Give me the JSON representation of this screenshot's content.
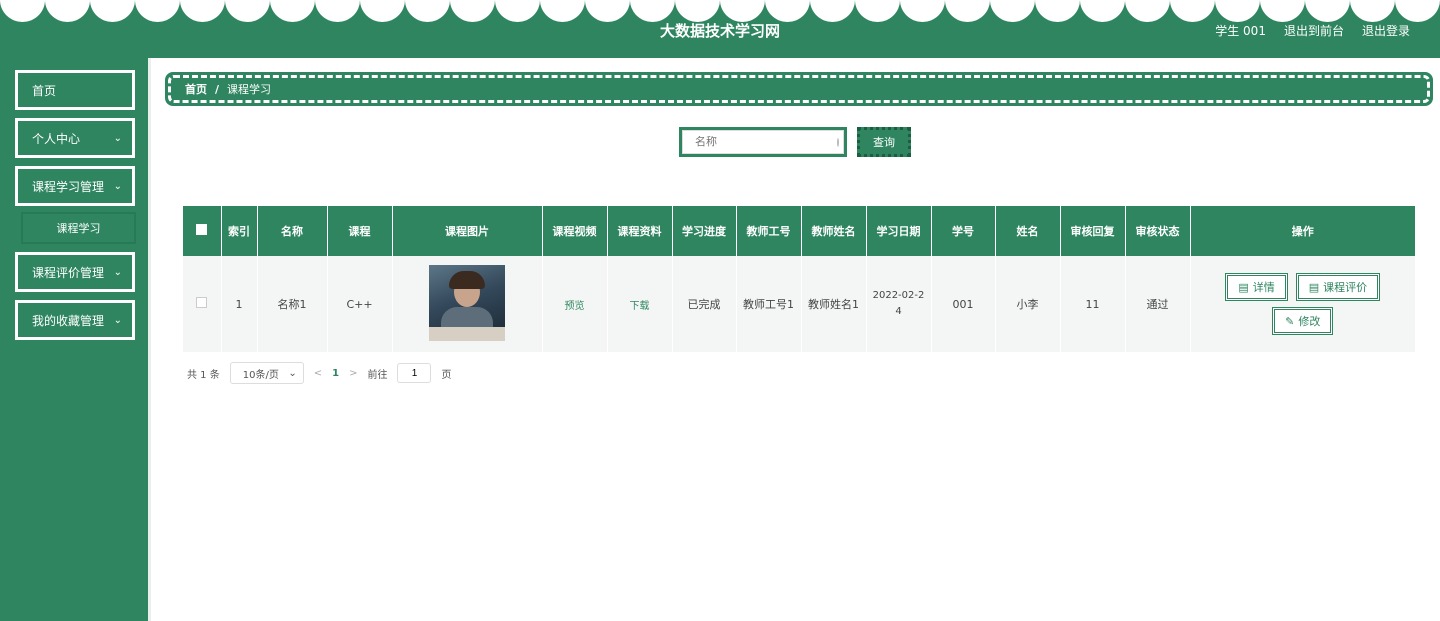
{
  "header": {
    "site_title": "大数据技术学习网",
    "user_label": "学生 001",
    "back_to_front": "退出到前台",
    "logout": "退出登录"
  },
  "sidebar": {
    "items": [
      {
        "label": "首页",
        "has_chevron": false
      },
      {
        "label": "个人中心",
        "has_chevron": true
      },
      {
        "label": "课程学习管理",
        "has_chevron": true
      },
      {
        "label": "课程评价管理",
        "has_chevron": true
      },
      {
        "label": "我的收藏管理",
        "has_chevron": true
      }
    ],
    "sub_item": "课程学习"
  },
  "breadcrumb": {
    "home": "首页",
    "separator": "/",
    "current": "课程学习"
  },
  "search": {
    "placeholder": "名称",
    "button": "查询"
  },
  "table": {
    "headers": [
      "索引",
      "名称",
      "课程",
      "课程图片",
      "课程视频",
      "课程资料",
      "学习进度",
      "教师工号",
      "教师姓名",
      "学习日期",
      "学号",
      "姓名",
      "审核回复",
      "审核状态",
      "操作"
    ],
    "rows": [
      {
        "index": "1",
        "name": "名称1",
        "course": "C++",
        "video": "预览",
        "material": "下载",
        "progress": "已完成",
        "teacher_id": "教师工号1",
        "teacher_name": "教师姓名1",
        "date": "2022-02-24",
        "student_id": "001",
        "student_name": "小李",
        "review_reply": "11",
        "review_status": "通过",
        "btn_detail": "详情",
        "btn_evaluate": "课程评价",
        "btn_edit": "修改"
      }
    ]
  },
  "pagination": {
    "total": "共 1 条",
    "page_size": "10条/页",
    "current_page": "1",
    "goto_label": "前往",
    "goto_value": "1",
    "page_suffix": "页"
  },
  "colors": {
    "primary": "#2e8560"
  }
}
